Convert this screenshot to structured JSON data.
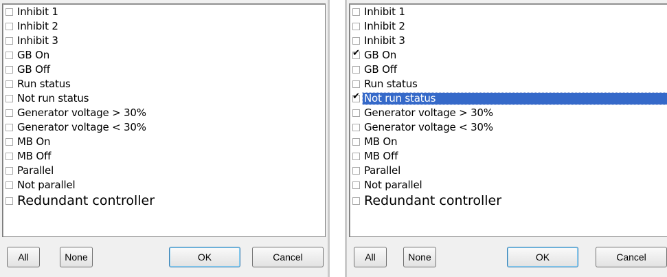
{
  "dialogs": [
    {
      "items": [
        {
          "label": "Inhibit 1",
          "checked": false,
          "selected": false
        },
        {
          "label": "Inhibit 2",
          "checked": false,
          "selected": false
        },
        {
          "label": "Inhibit 3",
          "checked": false,
          "selected": false
        },
        {
          "label": "GB On",
          "checked": false,
          "selected": false
        },
        {
          "label": "GB Off",
          "checked": false,
          "selected": false
        },
        {
          "label": "Run status",
          "checked": false,
          "selected": false
        },
        {
          "label": "Not run status",
          "checked": false,
          "selected": false
        },
        {
          "label": "Generator voltage > 30%",
          "checked": false,
          "selected": false
        },
        {
          "label": "Generator voltage < 30%",
          "checked": false,
          "selected": false
        },
        {
          "label": "MB On",
          "checked": false,
          "selected": false
        },
        {
          "label": "MB Off",
          "checked": false,
          "selected": false
        },
        {
          "label": "Parallel",
          "checked": false,
          "selected": false
        },
        {
          "label": "Not parallel",
          "checked": false,
          "selected": false
        },
        {
          "label": "Redundant controller",
          "checked": false,
          "selected": false
        }
      ],
      "buttons": {
        "all": "All",
        "none": "None",
        "ok": "OK",
        "cancel": "Cancel"
      }
    },
    {
      "items": [
        {
          "label": "Inhibit 1",
          "checked": false,
          "selected": false
        },
        {
          "label": "Inhibit 2",
          "checked": false,
          "selected": false
        },
        {
          "label": "Inhibit 3",
          "checked": false,
          "selected": false
        },
        {
          "label": "GB On",
          "checked": true,
          "selected": false
        },
        {
          "label": "GB Off",
          "checked": false,
          "selected": false
        },
        {
          "label": "Run status",
          "checked": false,
          "selected": false
        },
        {
          "label": "Not run status",
          "checked": true,
          "selected": true
        },
        {
          "label": "Generator voltage > 30%",
          "checked": false,
          "selected": false
        },
        {
          "label": "Generator voltage < 30%",
          "checked": false,
          "selected": false
        },
        {
          "label": "MB On",
          "checked": false,
          "selected": false
        },
        {
          "label": "MB Off",
          "checked": false,
          "selected": false
        },
        {
          "label": "Parallel",
          "checked": false,
          "selected": false
        },
        {
          "label": "Not parallel",
          "checked": false,
          "selected": false
        },
        {
          "label": "Redundant controller",
          "checked": false,
          "selected": false
        }
      ],
      "buttons": {
        "all": "All",
        "none": "None",
        "ok": "OK",
        "cancel": "Cancel"
      }
    }
  ],
  "colors": {
    "selection": "#3569c9",
    "dialog_bg": "#f0f0f0"
  }
}
